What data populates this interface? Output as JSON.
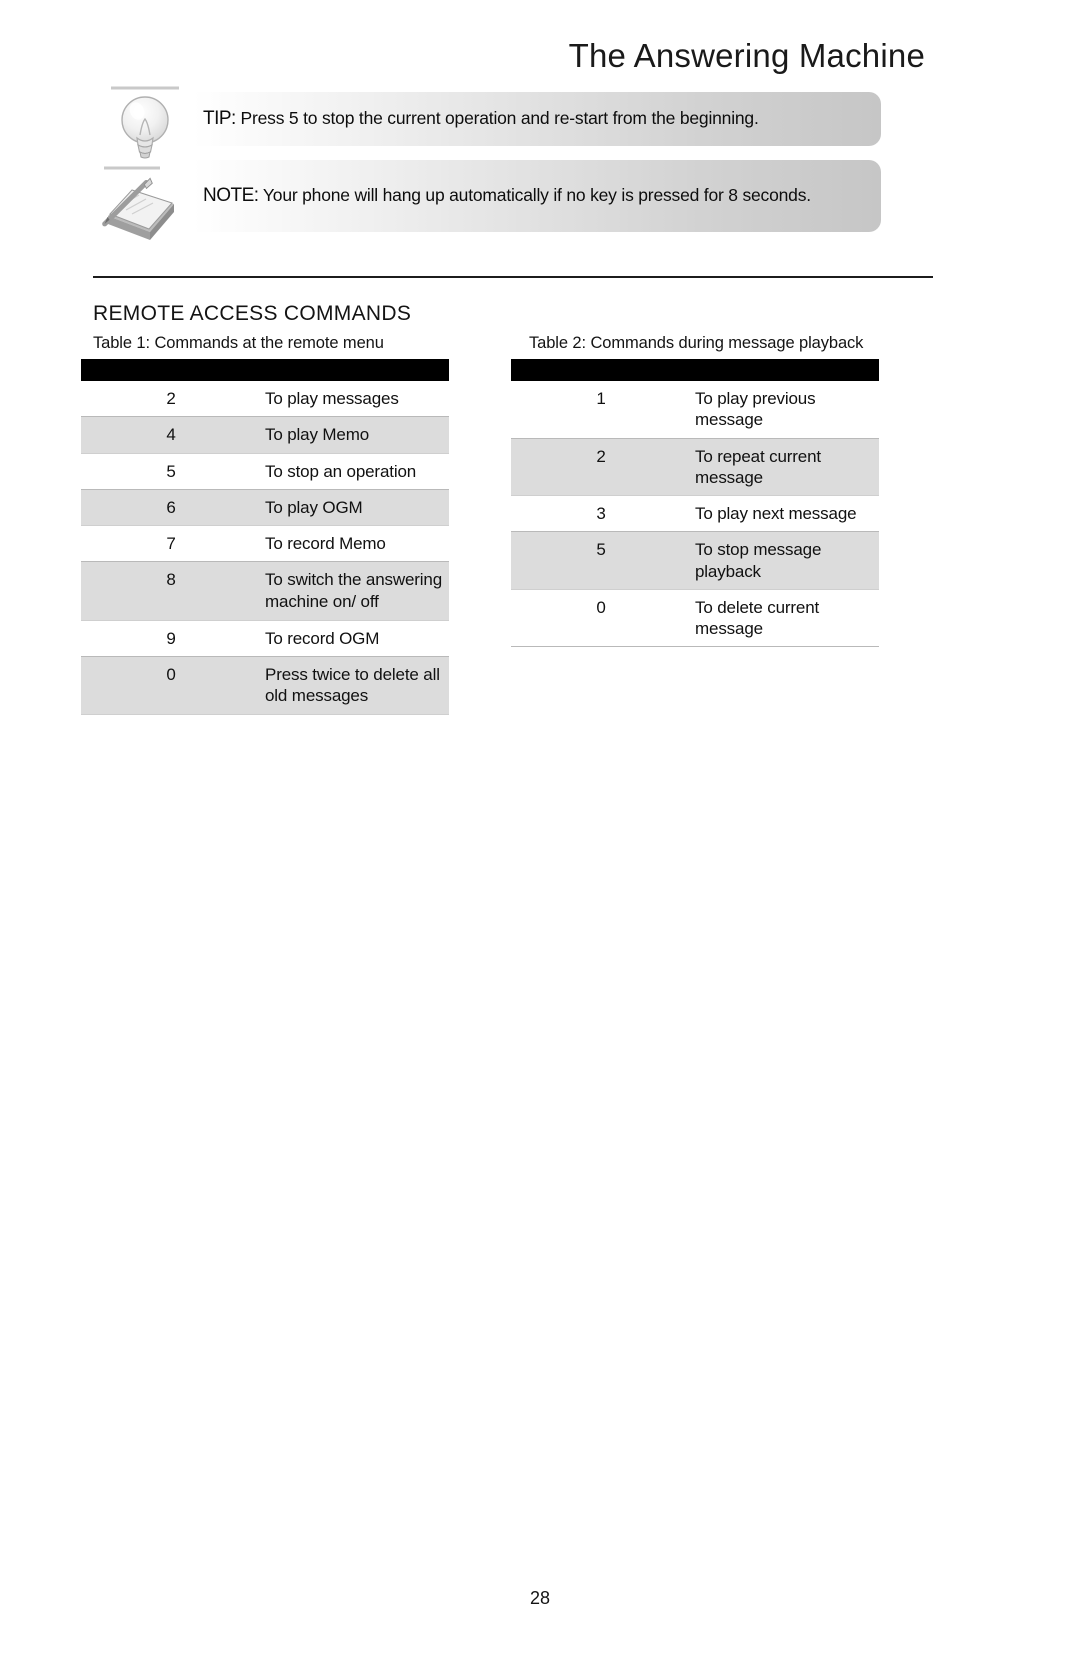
{
  "header": {
    "title": "The Answering Machine"
  },
  "callouts": [
    {
      "icon": "lightbulb-icon",
      "label": "TIP:",
      "text": "Press 5 to stop the current operation and re-start from the beginning."
    },
    {
      "icon": "notepad-pencil-icon",
      "label": "NOTE:",
      "text": "Your phone will hang up automatically if no key is pressed for 8 seconds."
    }
  ],
  "section": {
    "heading": "REMOTE ACCESS COMMANDS"
  },
  "tables": [
    {
      "caption": "Table 1: Commands at the remote menu",
      "rows": [
        {
          "key": "2",
          "description": "To play messages"
        },
        {
          "key": "4",
          "description": "To play Memo"
        },
        {
          "key": "5",
          "description": "To stop an operation"
        },
        {
          "key": "6",
          "description": "To play OGM"
        },
        {
          "key": "7",
          "description": "To record Memo"
        },
        {
          "key": "8",
          "description": "To switch the answering machine on/ off"
        },
        {
          "key": "9",
          "description": "To record OGM"
        },
        {
          "key": "0",
          "description": "Press twice to delete all old messages"
        }
      ]
    },
    {
      "caption": "Table 2: Commands during message playback",
      "rows": [
        {
          "key": "1",
          "description": "To play previous message"
        },
        {
          "key": "2",
          "description": "To repeat current message"
        },
        {
          "key": "3",
          "description": "To play next message"
        },
        {
          "key": "5",
          "description": "To stop message playback"
        },
        {
          "key": "0",
          "description": "To delete current message"
        }
      ]
    }
  ],
  "footer": {
    "page_number": "28"
  },
  "colors": {
    "header_bar": "#000000",
    "row_alt": "#dcdcdc",
    "callout_gradient_end": "#c6c6c6",
    "text": "#111111"
  }
}
